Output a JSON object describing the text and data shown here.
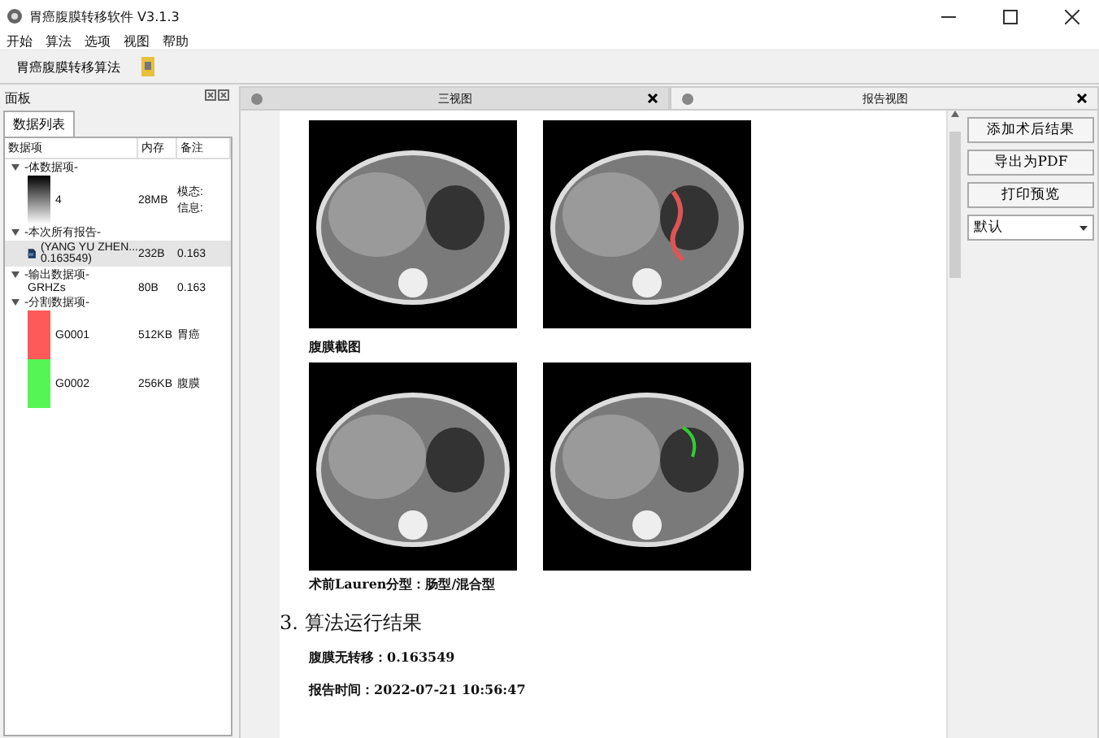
{
  "window": {
    "title": "胃癌腹膜转移软件 V3.1.3"
  },
  "menu": [
    "开始",
    "算法",
    "选项",
    "视图",
    "帮助"
  ],
  "toolbar": {
    "label": "胃癌腹膜转移算法"
  },
  "panel": {
    "title": "面板",
    "tabs": [
      {
        "label": "数据列表",
        "selected": true
      }
    ],
    "columns": [
      "数据项",
      "内存",
      "备注"
    ],
    "tree": [
      {
        "label": "-体数据项-",
        "expanded": true,
        "children": [
          {
            "kind": "volume",
            "name": "4",
            "size": "28MB",
            "note": "模态:\n信息:"
          }
        ]
      },
      {
        "label": "-本次所有报告-",
        "expanded": true,
        "children": [
          {
            "kind": "pdf",
            "name": "(YANG YU ZHEN...\n0.163549)",
            "size": "232B",
            "note": "0.163",
            "selected": true
          }
        ]
      },
      {
        "label": "-输出数据项-",
        "expanded": true,
        "children": [
          {
            "kind": "text",
            "name": "GRHZs",
            "size": "80B",
            "note": "0.163",
            "selected": false
          }
        ]
      },
      {
        "label": "-分割数据项-",
        "expanded": true,
        "children": [
          {
            "kind": "mask",
            "name": "G0001",
            "size": "512KB",
            "note": "胃癌",
            "color": "#ff5a5a",
            "selected": false
          },
          {
            "kind": "mask",
            "name": "G0002",
            "size": "256KB",
            "note": "腹膜",
            "color": "#55f555",
            "selected": false
          }
        ]
      }
    ]
  },
  "view_tabs": [
    {
      "label": "三视图",
      "selected": false
    },
    {
      "label": "报告视图",
      "selected": true
    }
  ],
  "report": {
    "section1_caption": "腹膜截图",
    "lauren": "术前Lauren分型：肠型/混合型",
    "heading": "3.  算法运行结果",
    "result": "腹膜无转移：0.163549",
    "time": "报告时间：2022-07-21 10:56:47"
  },
  "actions": [
    "添加术后结果",
    "导出为PDF",
    "打印预览"
  ],
  "template_select": {
    "value": "默认"
  }
}
